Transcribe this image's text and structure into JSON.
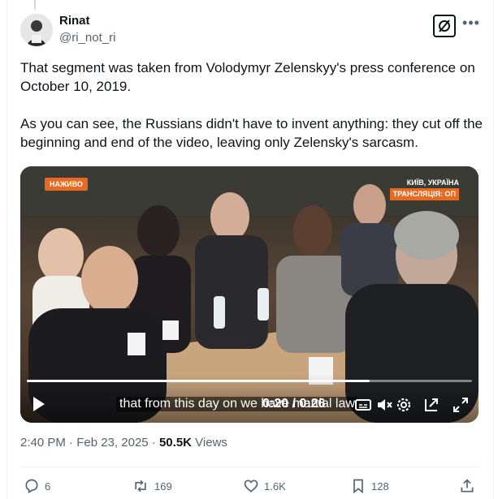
{
  "author": {
    "name": "Rinat",
    "handle": "@ri_not_ri"
  },
  "tweet": {
    "paragraph_1": "That segment was taken from Volodymyr Zelenskyy's press conference on October 10, 2019.",
    "paragraph_2": "As you can see, the Russians didn't have to invent anything: they cut off the beginning and end of the video, leaving only Zelensky's sarcasm."
  },
  "video": {
    "live_badge": "НАЖИВО",
    "location": "КИЇВ, УКРАЇНА",
    "broadcast": "ТРАНСЛЯЦІЯ: ОП",
    "caption": "that from this day on we have martial law",
    "time": "0:20 / 0:26",
    "progress": 0.77
  },
  "meta": {
    "time": "2:40 PM",
    "date": "Feb 23, 2025",
    "views_count": "50.5K",
    "views_label": "Views"
  },
  "actions": {
    "replies": "6",
    "reposts": "169",
    "likes": "1.6K",
    "bookmarks": "128"
  },
  "colors": {
    "text": "#0f1419",
    "secondary": "#536471",
    "accent_badge": "#e86a1f"
  }
}
